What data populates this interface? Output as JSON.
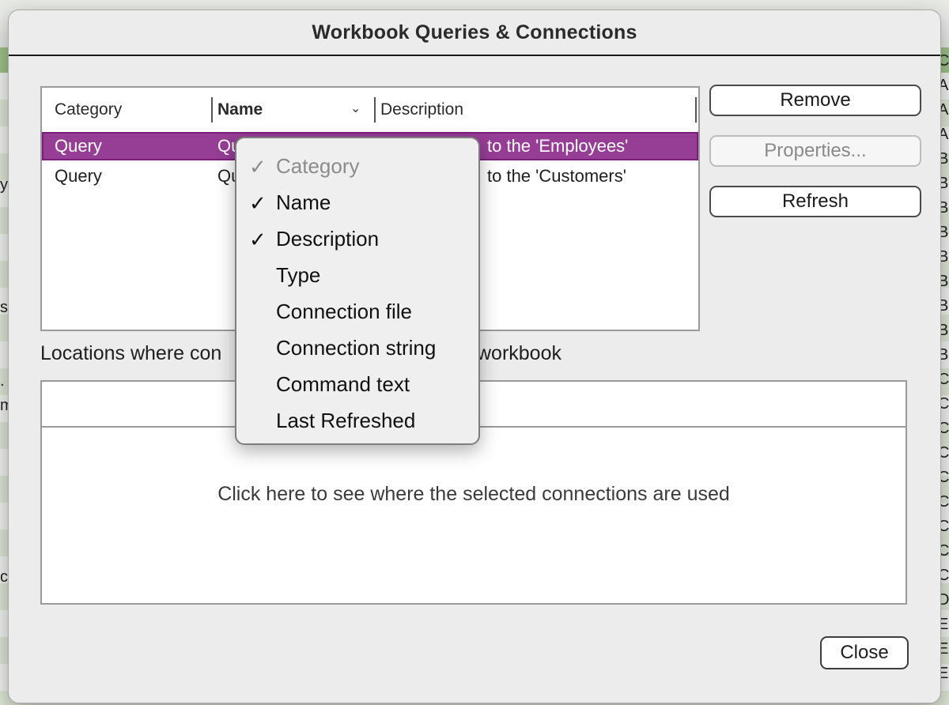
{
  "dialog": {
    "title": "Workbook Queries & Connections"
  },
  "list": {
    "columns": {
      "category": "Category",
      "name": "Name",
      "description": "Description"
    },
    "rows": [
      {
        "category": "Query",
        "name": "Qu",
        "description": "to the 'Employees'",
        "selected": true
      },
      {
        "category": "Query",
        "name": "Qu",
        "description": "to the 'Customers'",
        "selected": false
      }
    ]
  },
  "buttons": {
    "remove": "Remove",
    "properties": "Properties...",
    "refresh": "Refresh",
    "close": "Close"
  },
  "locations": {
    "label_left": "Locations where con",
    "label_right": "workbook",
    "hint": "Click here to see where the selected connections are used"
  },
  "column_menu": {
    "items": [
      {
        "label": "Category",
        "checked": true,
        "disabled": true
      },
      {
        "label": "Name",
        "checked": true,
        "disabled": false
      },
      {
        "label": "Description",
        "checked": true,
        "disabled": false
      },
      {
        "label": "Type",
        "checked": false,
        "disabled": false
      },
      {
        "label": "Connection file",
        "checked": false,
        "disabled": false
      },
      {
        "label": "Connection string",
        "checked": false,
        "disabled": false
      },
      {
        "label": "Command text",
        "checked": false,
        "disabled": false
      },
      {
        "label": "Last Refreshed",
        "checked": false,
        "disabled": false
      }
    ],
    "check_glyph": "✓"
  },
  "background_sheet": {
    "left_fragments": [
      "y",
      "s",
      ".",
      "m",
      "ch"
    ],
    "right_fragments": [
      "Ci",
      "Al",
      "Ar",
      "Au",
      "Ba",
      "Be",
      "Bi",
      "Br",
      "Bu",
      "Be",
      "Br",
      "Bo",
      "Ba",
      "Ca",
      "Co",
      "Co",
      "Co",
      "Ce",
      "Co",
      "Co",
      "Ce",
      "Ca",
      "Du",
      "El",
      "Ea",
      "Ea"
    ]
  },
  "colors": {
    "selection": "#963d96",
    "sheet_header": "#9ec48a"
  }
}
